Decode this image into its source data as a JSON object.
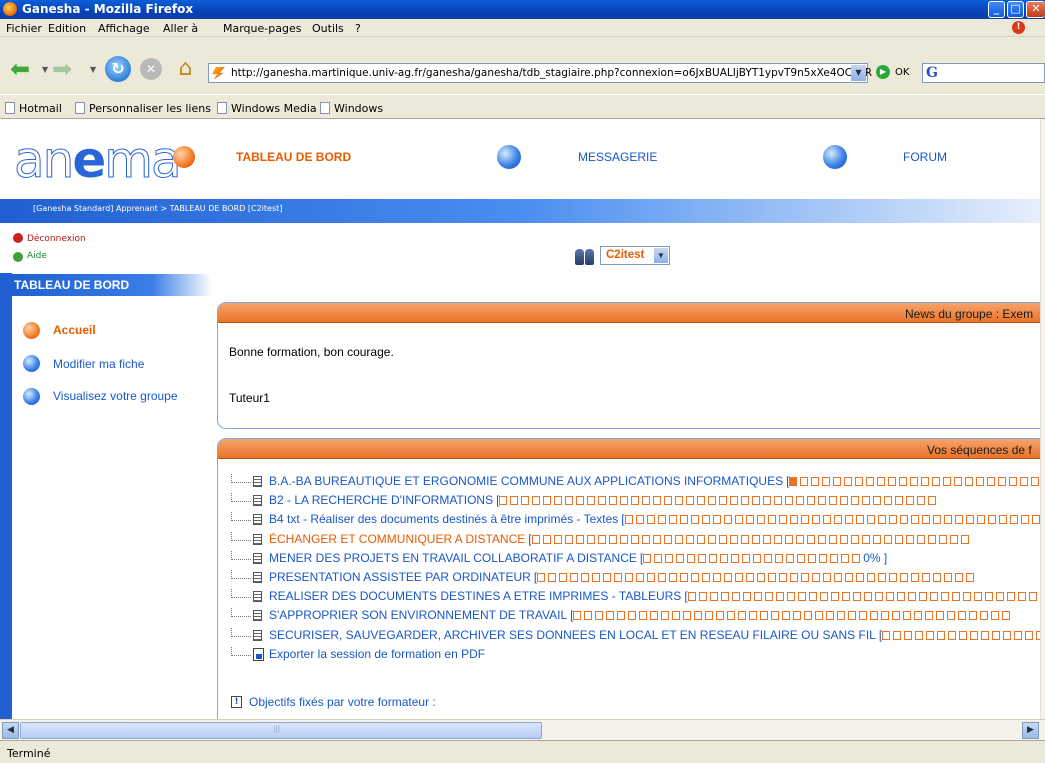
{
  "window": {
    "title": "Ganesha - Mozilla Firefox"
  },
  "menu": [
    "Fichier",
    "Edition",
    "Affichage",
    "Aller à",
    "Marque-pages",
    "Outils",
    "?"
  ],
  "nav": {
    "url": "http://ganesha.martinique.univ-ag.fr/ganesha/ganesha/tdb_stagiaire.php?connexion=o6JxBUALIjBYT1ypvT9n5xXe4OCzVR",
    "go_label": "OK"
  },
  "bookmarks": [
    "Hotmail",
    "Personnaliser les liens",
    "Windows Media",
    "Windows"
  ],
  "site": {
    "logo": {
      "part1": "an",
      "part2": "e",
      "part3": "ma"
    },
    "topnav": {
      "tdb": "TABLEAU DE BORD",
      "messagerie": "MESSAGERIE",
      "forum": "FORUM"
    },
    "breadcrumb": "[Ganesha Standard] Apprenant > TABLEAU DE BORD [C2itest]",
    "links": {
      "logout": "Déconnexion",
      "help": "Aide"
    },
    "section_label": "TABLEAU DE BORD",
    "sidemenu": [
      "Accueil",
      "Modifier ma fiche",
      "Visualisez votre groupe"
    ],
    "group_select": "C2itest"
  },
  "news": {
    "title": "News du groupe : Exem",
    "line1": "Bonne formation, bon courage.",
    "line2": "Tuteur1"
  },
  "sequences": {
    "title": "Vos séquences de f",
    "items": [
      {
        "label": "B.A.-BA BUREAUTIQUE ET ERGONOMIE COMMUNE AUX APPLICATIONS INFORMATIQUES",
        "progress_cells_filled": 1
      },
      {
        "label": "B2 - LA RECHERCHE D'INFORMATIONS",
        "progress_cells_filled": 0
      },
      {
        "label": "B4 txt - Réaliser des documents destinés à être imprimés - Textes",
        "progress_cells_filled": 0
      },
      {
        "label": "ÉCHANGER ET COMMUNIQUER A DISTANCE",
        "progress_cells_filled": 0
      },
      {
        "label": "MENER DES PROJETS EN TRAVAIL COLLABORATIF A DISTANCE",
        "progress_cells_filled": 0,
        "percent_label": "0%"
      },
      {
        "label": "PRESENTATION ASSISTEE PAR ORDINATEUR",
        "progress_cells_filled": 0
      },
      {
        "label": "REALISER DES DOCUMENTS DESTINES A ETRE IMPRIMES - TABLEURS",
        "progress_cells_filled": 0
      },
      {
        "label": "S'APPROPRIER SON ENVIRONNEMENT DE TRAVAIL",
        "progress_cells_filled": 0
      },
      {
        "label": "SECURISER, SAUVEGARDER, ARCHIVER SES DONNEES EN LOCAL ET EN RESEAU FILAIRE OU SANS FIL",
        "progress_cells_filled": 0
      }
    ],
    "export_label": "Exporter la session de formation en PDF",
    "goal_label": "Objectifs fixés par votre formateur :"
  },
  "status": "Terminé",
  "colors": {
    "accent_orange": "#e65c00",
    "link_blue": "#1858c8",
    "brand_blue": "#2060d0"
  }
}
